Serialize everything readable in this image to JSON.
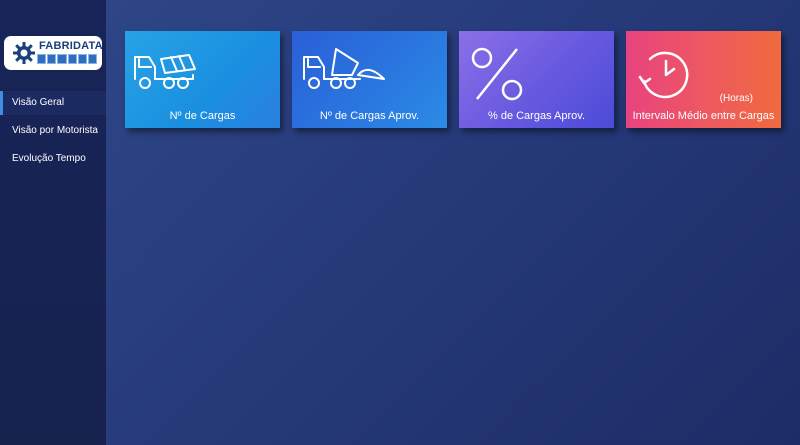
{
  "logo": {
    "text": "FABRIDATA"
  },
  "nav": {
    "items": [
      {
        "label": "Visão Geral"
      },
      {
        "label": "Visão por Motorista"
      },
      {
        "label": "Evolução Tempo"
      }
    ]
  },
  "cards": [
    {
      "label": "Nº de Cargas",
      "icon": "mixer-truck-icon"
    },
    {
      "label": "Nº de Cargas Aprov.",
      "icon": "tipper-truck-icon"
    },
    {
      "label": "%  de Cargas Aprov.",
      "icon": "percent-icon"
    },
    {
      "label": "Intervalo Médio entre Cargas",
      "sub": "(Horas)",
      "icon": "clock-refresh-icon"
    }
  ],
  "colors": {
    "sidebar": "#182458",
    "main": "#2a3f80",
    "active_indicator": "#3f8de0",
    "card1": "#1a8fe0",
    "card2": "#2a78e0",
    "card3": "#6a5be0",
    "card4": "#ee5a5e"
  }
}
